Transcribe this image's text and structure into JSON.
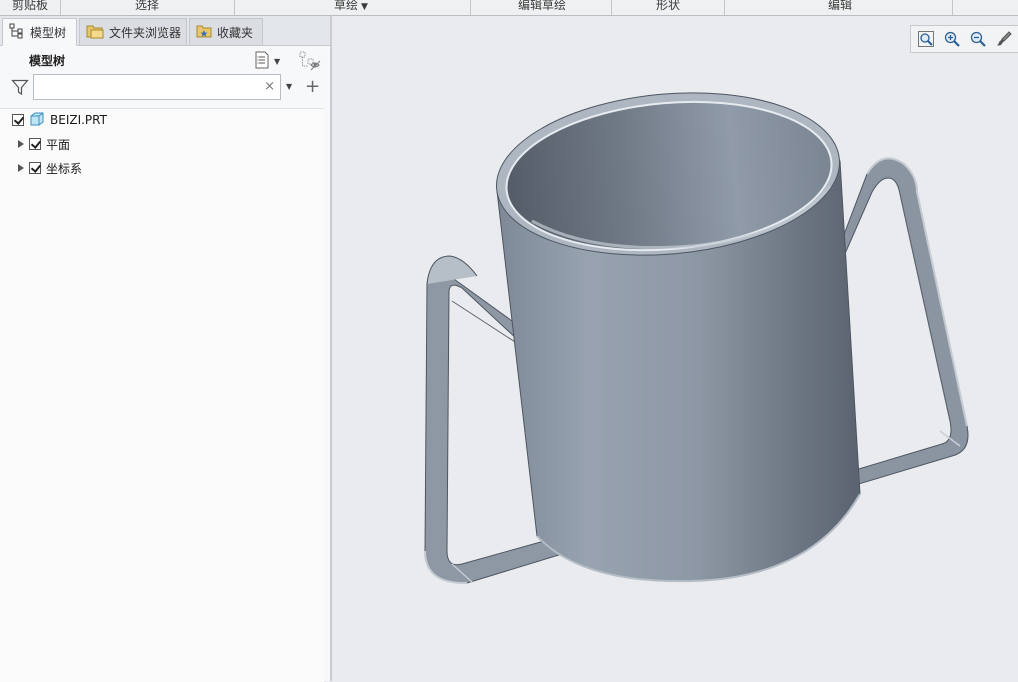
{
  "ribbon": {
    "groups": [
      "剪贴板",
      "选择",
      "草绘",
      "编辑草绘",
      "形状",
      "编辑"
    ]
  },
  "panel": {
    "tabs": [
      {
        "label": "模型树",
        "icon": "model-tree-icon",
        "active": true
      },
      {
        "label": "文件夹浏览器",
        "icon": "folder-browser-icon",
        "active": false
      },
      {
        "label": "收藏夹",
        "icon": "favorites-icon",
        "active": false
      }
    ],
    "title": "模型树",
    "filter": {
      "value": "",
      "placeholder": ""
    }
  },
  "tree": {
    "root": {
      "label": "BEIZI.PRT",
      "checked": true,
      "icon": "part-icon"
    },
    "children": [
      {
        "label": "平面",
        "checked": true,
        "expandable": true
      },
      {
        "label": "坐标系",
        "checked": true,
        "expandable": true
      }
    ]
  },
  "view_toolbar": {
    "buttons": [
      "refit-icon",
      "zoom-in-icon",
      "zoom-out-icon",
      "repaint-icon"
    ]
  },
  "colors": {
    "model_body": "#8d98a5",
    "model_dark": "#5f6874",
    "model_light": "#b3bcc6",
    "background": "#e9ebee"
  }
}
